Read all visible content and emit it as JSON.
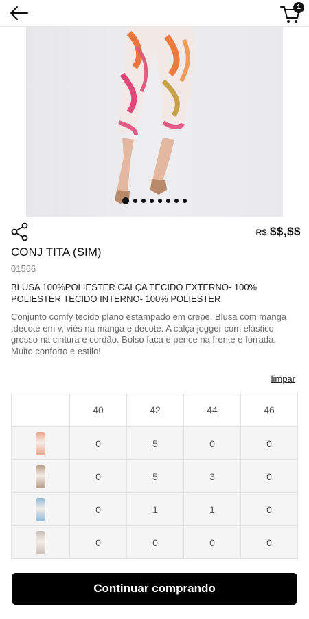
{
  "header": {
    "cart_count": "1",
    "icons": [
      "back-arrow-icon",
      "cart-icon"
    ]
  },
  "product": {
    "price_currency": "R$",
    "price_value": "$$,$$",
    "name": "CONJ TITA (SIM)",
    "code": "01566",
    "composition": "BLUSA 100%POLIESTER CALÇA TECIDO EXTERNO- 100% POLIESTER TECIDO INTERNO- 100% POLIESTER",
    "description": "Conjunto comfy tecido plano estampado em crepe. Blusa com manga ,decote em v, viés na manga e decote. A calça jogger com elástico grosso na cintura e cordão. Bolso faca e pence na frente e forrada. Muito conforto e estilo!"
  },
  "carousel": {
    "total": 8,
    "active": 1
  },
  "grid": {
    "clear_label": "limpar",
    "sizes": [
      "40",
      "42",
      "44",
      "46"
    ],
    "rows": [
      {
        "color": "#e9a28a",
        "values": [
          "0",
          "5",
          "0",
          "0"
        ]
      },
      {
        "color": "#b39a84",
        "values": [
          "0",
          "5",
          "3",
          "0"
        ]
      },
      {
        "color": "#8fb7d8",
        "values": [
          "0",
          "1",
          "1",
          "0"
        ]
      },
      {
        "color": "#c9bfb7",
        "values": [
          "0",
          "0",
          "0",
          "0"
        ]
      }
    ]
  },
  "footer": {
    "continue_label": "Continuar comprando"
  }
}
